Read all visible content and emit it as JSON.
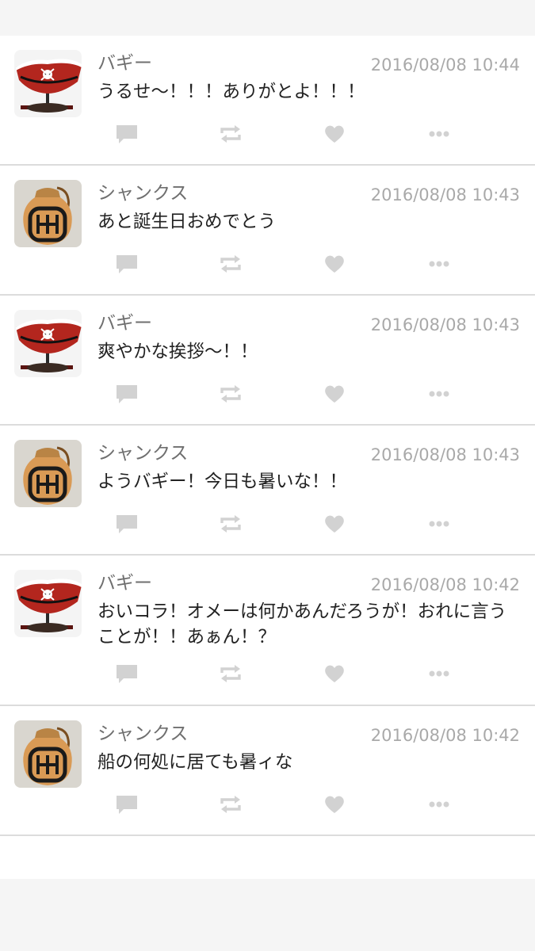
{
  "posts": [
    {
      "avatar": "buggy-hat-icon",
      "name": "バギー",
      "time": "2016/08/08 10:44",
      "text": "うるせ〜！！！ありがとよ！！！"
    },
    {
      "avatar": "sake-jug-icon",
      "name": "シャンクス",
      "time": "2016/08/08 10:43",
      "text": "あと誕生日おめでとう"
    },
    {
      "avatar": "buggy-hat-icon",
      "name": "バギー",
      "time": "2016/08/08 10:43",
      "text": "爽やかな挨拶〜！！"
    },
    {
      "avatar": "sake-jug-icon",
      "name": "シャンクス",
      "time": "2016/08/08 10:43",
      "text": "ようバギー！今日も暑いな！！"
    },
    {
      "avatar": "buggy-hat-icon",
      "name": "バギー",
      "time": "2016/08/08 10:42",
      "text": "おいコラ！オメーは何かあんだろうが！おれに言うことが！！あぁん！？"
    },
    {
      "avatar": "sake-jug-icon",
      "name": "シャンクス",
      "time": "2016/08/08 10:42",
      "text": "船の何処に居ても暑ィな"
    }
  ],
  "actions": [
    "comment-icon",
    "repost-icon",
    "like-icon",
    "more-icon"
  ],
  "colors": {
    "icon": "#d2d2d2",
    "name": "#6f6f6f",
    "time": "#a9a9a9",
    "text": "#222222",
    "divider": "#dcdcdc",
    "hat_red": "#b3261e",
    "jug_orange": "#d99a55"
  }
}
